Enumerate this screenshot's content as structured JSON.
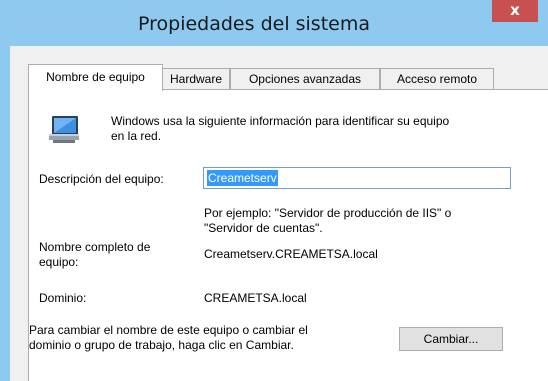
{
  "window": {
    "title": "Propiedades del sistema",
    "close_label": "x",
    "accent_color": "#8ec9ef"
  },
  "tabs": [
    {
      "label": "Nombre de equipo",
      "active": true
    },
    {
      "label": "Hardware",
      "active": false
    },
    {
      "label": "Opciones avanzadas",
      "active": false
    },
    {
      "label": "Acceso remoto",
      "active": false
    }
  ],
  "panel": {
    "icon": "computer-icon",
    "intro_line1": "Windows usa la siguiente información para identificar su equipo",
    "intro_line2": "en la red.",
    "description_label": "Descripción del equipo:",
    "description_value": "Creametserv",
    "example_line1": "Por ejemplo: \"Servidor de producción de IIS\" o",
    "example_line2": "\"Servidor de cuentas\".",
    "full_name_label_line1": "Nombre completo de",
    "full_name_label_line2": "equipo:",
    "full_name_value": "Creametserv.CREAMETSA.local",
    "domain_label": "Dominio:",
    "domain_value": "CREAMETSA.local",
    "change_text_line1": "Para cambiar el nombre de este equipo o cambiar el",
    "change_text_line2": "dominio o grupo de trabajo, haga clic en Cambiar.",
    "change_button": "Cambiar..."
  }
}
